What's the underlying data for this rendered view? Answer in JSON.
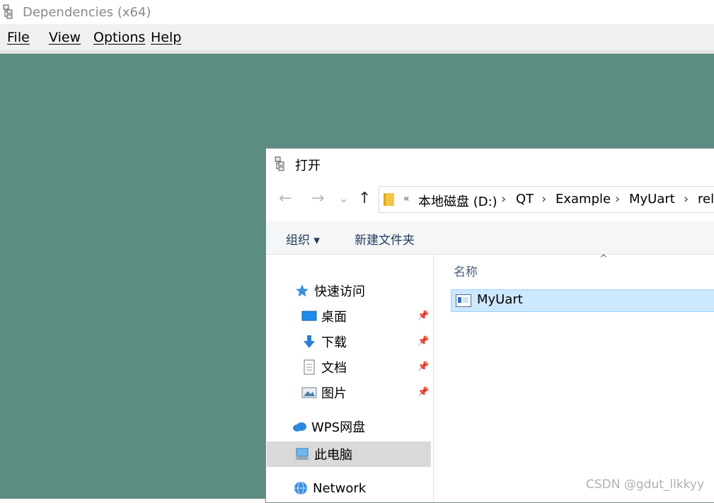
{
  "window": {
    "title": "Dependencies (x64)"
  },
  "menu": {
    "file": "File",
    "view": "View",
    "options": "Options",
    "help": "Help"
  },
  "dialog": {
    "title": "打开",
    "nav": {
      "back": "←",
      "forward": "→",
      "recent": "⌄",
      "up": "↑"
    },
    "address": {
      "overflow": "«",
      "segments": [
        "本地磁盘 (D:)",
        "QT",
        "Example",
        "MyUart",
        "rele"
      ],
      "separator": "›"
    },
    "commands": {
      "organize": "组织 ▾",
      "new_folder": "新建文件夹"
    },
    "navpane": {
      "quick_access": "快速访问",
      "desktop": "桌面",
      "downloads": "下载",
      "documents": "文档",
      "pictures": "图片",
      "wps": "WPS网盘",
      "this_pc": "此电脑",
      "network": "Network"
    },
    "list": {
      "column_name": "名称",
      "sort_indicator": "^",
      "items": [
        "MyUart"
      ]
    }
  },
  "watermark": "CSDN @gdut_llkkyy"
}
